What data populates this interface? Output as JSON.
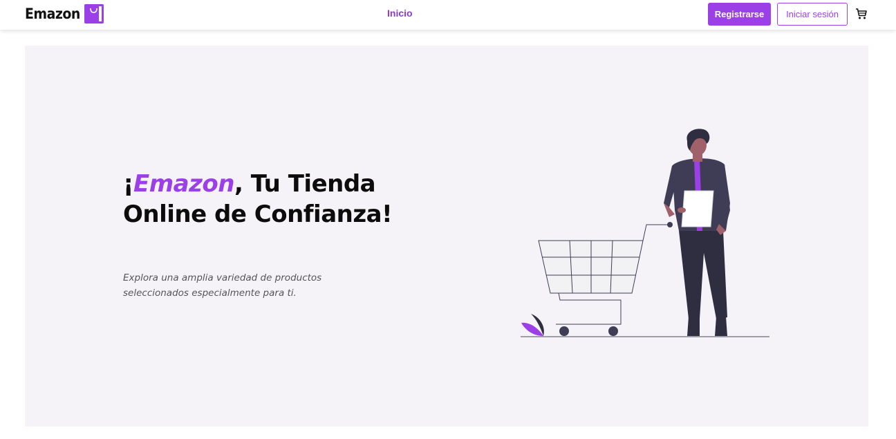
{
  "navbar": {
    "brand": "Emazon",
    "brand_icon": "shopping-bag-icon",
    "links": [
      {
        "label": "Inicio"
      }
    ],
    "register_label": "Registrarse",
    "login_label": "Iniciar sesión",
    "cart_icon": "cart-icon"
  },
  "hero": {
    "title_prefix": "¡",
    "title_brand": "Emazon",
    "title_rest": ", Tu Tienda Online de Confianza!",
    "subtitle": "Explora una amplia variedad de productos seleccionados especialmente para ti.",
    "illustration": "person-with-shopping-cart-illustration"
  },
  "colors": {
    "accent": "#9b3fe6",
    "hero_background": "#f5f3f7",
    "text_dark": "#0c0c0c",
    "figure_dark": "#3f3d56"
  }
}
